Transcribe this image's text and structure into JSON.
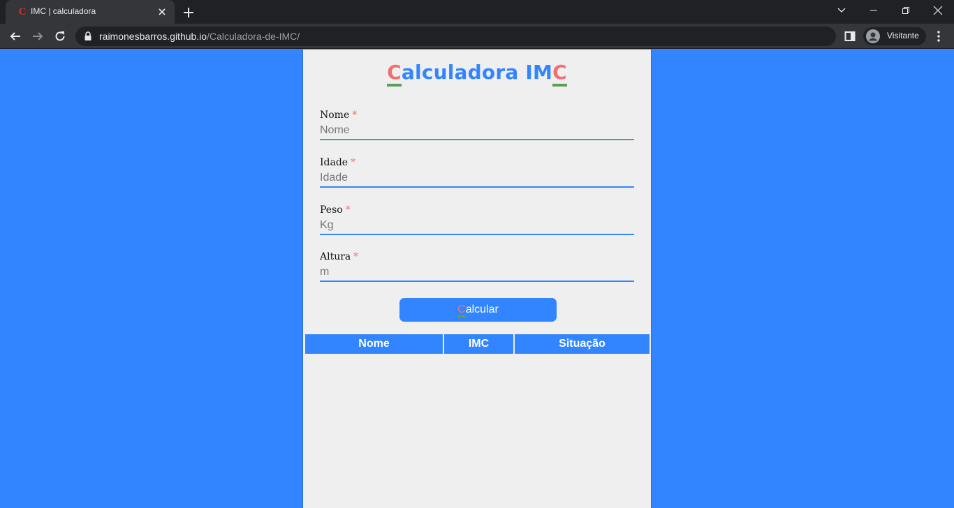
{
  "browser": {
    "tab_title": "IMC | calculadora",
    "favicon_letter": "C",
    "url_host": "raimonesbarros.github.io",
    "url_path": "/Calculadora-de-IMC/",
    "profile_name": "Visitante"
  },
  "page": {
    "title_first_letter": "C",
    "title_middle": "alculadora IM",
    "title_last_letter": "C",
    "required_mark": "*",
    "fields": [
      {
        "label": "Nome",
        "placeholder": "Nome",
        "value": ""
      },
      {
        "label": "Idade",
        "placeholder": "Idade",
        "value": ""
      },
      {
        "label": "Peso",
        "placeholder": "Kg",
        "value": ""
      },
      {
        "label": "Altura",
        "placeholder": "m",
        "value": ""
      }
    ],
    "button_first_letter": "C",
    "button_rest": "alcular",
    "table_headers": [
      "Nome",
      "IMC",
      "Situação"
    ]
  },
  "colors": {
    "page_background": "#3385ff",
    "card_background": "#efefef",
    "accent_red": "#f07070",
    "accent_green": "#5aa05a"
  }
}
